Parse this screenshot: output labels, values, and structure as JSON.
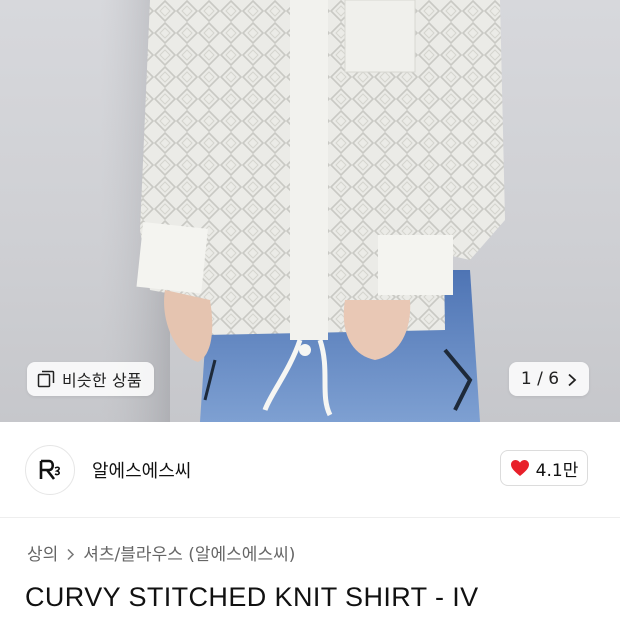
{
  "hero": {
    "similar_label": "비슷한 상품",
    "page_counter": "1 / 6"
  },
  "store": {
    "name": "알에스에스씨",
    "like_count": "4.1만",
    "like_color": "#e8202a"
  },
  "breadcrumb": {
    "category": "상의",
    "subcategory": "셔츠/블라우스 (알에스에스씨)"
  },
  "product": {
    "title": "CURVY STITCHED KNIT SHIRT - IV"
  },
  "icons": [
    "similar-products-icon",
    "chevron-right-icon",
    "heart-icon",
    "store-logo"
  ]
}
